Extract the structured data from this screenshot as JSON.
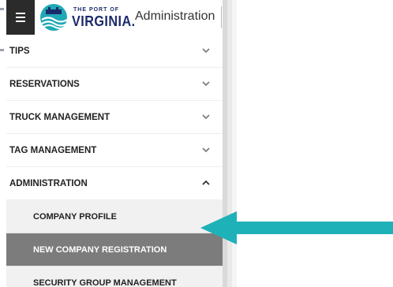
{
  "header": {
    "logo_small": "THE PORT OF",
    "logo_big": "VIRGINIA.",
    "title": "Administration"
  },
  "menu": {
    "items": [
      {
        "label": "TIPS",
        "expanded": false
      },
      {
        "label": "RESERVATIONS",
        "expanded": false
      },
      {
        "label": "TRUCK MANAGEMENT",
        "expanded": false
      },
      {
        "label": "TAG MANAGEMENT",
        "expanded": false
      },
      {
        "label": "ADMINISTRATION",
        "expanded": true
      }
    ],
    "sub_items": [
      {
        "label": "COMPANY PROFILE",
        "active": false
      },
      {
        "label": "NEW COMPANY REGISTRATION",
        "active": true
      },
      {
        "label": "SECURITY GROUP MANAGEMENT",
        "active": false
      }
    ]
  },
  "colors": {
    "hamburger_bg": "#2b2b2b",
    "logo_navy": "#1b2a6b",
    "logo_teal": "#1fa9b6",
    "active_item_bg": "#7c7c7c",
    "sub_item_bg": "#f1f1f1",
    "arrow": "#1fb1b8"
  },
  "icons": [
    "hamburger-menu-icon",
    "port-logo-icon",
    "chevron-down-icon",
    "chevron-up-icon",
    "pointer-arrow-icon"
  ]
}
